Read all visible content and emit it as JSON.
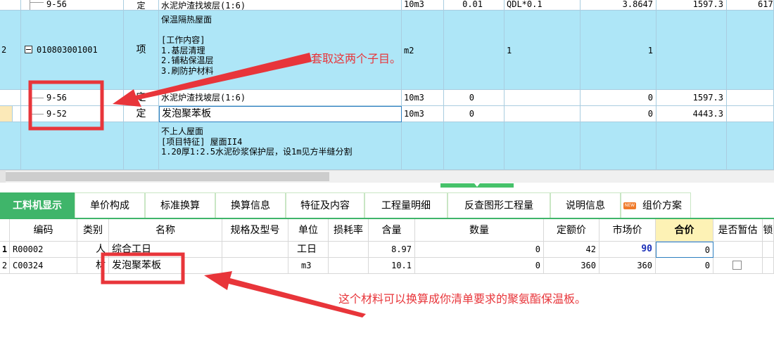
{
  "top_rows": [
    {
      "num": "",
      "code": "9-56",
      "type": "定",
      "name": "水泥炉渣找坡层(1:6)",
      "unit": "10m3",
      "content": "0.01",
      "qty_expr": "QDL*0.1",
      "qty": "3.8647",
      "price": "1597.3",
      "total": "617"
    },
    {
      "num": "2",
      "code": "010803001001",
      "type": "项",
      "name": "保温隔热屋面\n\n[工作内容]\n1.基层清理\n2.铺粘保温层\n3.刷防护材料",
      "unit": "m2",
      "content": "",
      "qty_expr": "1",
      "qty": "1",
      "price": "",
      "total": ""
    },
    {
      "num": "",
      "code": "9-56",
      "type": "定",
      "name": "水泥炉渣找坡层(1:6)",
      "unit": "10m3",
      "content": "0",
      "qty_expr": "",
      "qty": "0",
      "price": "1597.3",
      "total": ""
    },
    {
      "num": "",
      "code": "9-52",
      "type": "定",
      "name": "发泡聚苯板",
      "unit": "10m3",
      "content": "0",
      "qty_expr": "",
      "qty": "0",
      "price": "4443.3",
      "total": ""
    },
    {
      "num": "",
      "code": "",
      "type": "",
      "name": "不上人屋面\n[项目特征] 屋面II4\n1.20厚1:2.5水泥砂浆保护层，设1m见方半缝分割",
      "unit": "",
      "content": "",
      "qty_expr": "",
      "qty": "",
      "price": "",
      "total": ""
    }
  ],
  "tabs": [
    "工料机显示",
    "单价构成",
    "标准换算",
    "换算信息",
    "特征及内容",
    "工程量明细",
    "反查图形工程量",
    "说明信息",
    "组价方案"
  ],
  "new_badge": "NEW",
  "headers": [
    "编码",
    "类别",
    "名称",
    "规格及型号",
    "单位",
    "损耗率",
    "含量",
    "数量",
    "定额价",
    "市场价",
    "合价",
    "是否暂估",
    "锁"
  ],
  "rows": [
    {
      "num": "1",
      "code": "R00002",
      "cat": "人",
      "name": "综合工日",
      "spec": "",
      "unit": "工日",
      "loss": "",
      "content": "8.97",
      "qty": "0",
      "quota": "42",
      "market": "90",
      "total": "0"
    },
    {
      "num": "2",
      "code": "C00324",
      "cat": "材",
      "name": "发泡聚苯板",
      "spec": "",
      "unit": "m3",
      "loss": "",
      "content": "10.1",
      "qty": "0",
      "quota": "360",
      "market": "360",
      "total": "0"
    }
  ],
  "annotations": {
    "top": "套取这两个子目。",
    "bottom": "这个材料可以换算成你清单要求的聚氨酯保温板。"
  },
  "colors": {
    "highlight": "#aee6f7",
    "annotation": "#e8353a",
    "active_tab": "#3fb56a"
  }
}
